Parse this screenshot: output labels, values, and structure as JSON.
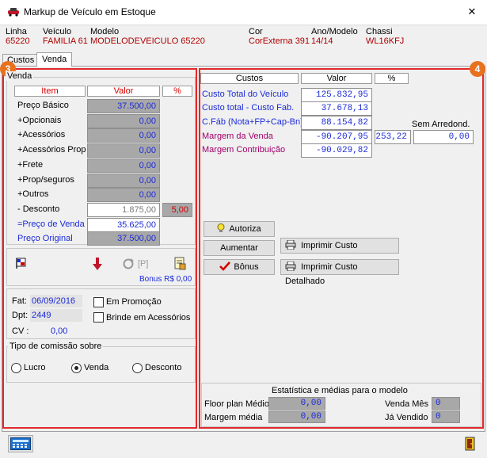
{
  "window": {
    "title": "Markup de Veículo em Estoque",
    "close": "✕"
  },
  "header": {
    "labels": {
      "linha": "Linha",
      "veiculo": "Veículo",
      "modelo": "Modelo",
      "cor": "Cor",
      "ano": "Ano/Modelo",
      "chassi": "Chassi"
    },
    "values": {
      "linha": "65220",
      "veiculo": "FAMILIA 61",
      "modelo": "MODELODEVEICULO 65220",
      "cor": "CorExterna 391",
      "ano": "14/14",
      "chassi": "WL16KFJ"
    }
  },
  "tabs": {
    "custos": "Custos",
    "venda": "Venda"
  },
  "badges": {
    "left": "3",
    "right": "4"
  },
  "venda": {
    "group_title": "Venda",
    "col_item": "Item",
    "col_valor": "Valor",
    "col_pct": "%",
    "rows": [
      {
        "label": "Preço Básico",
        "value": "37.500,00"
      },
      {
        "label": "+Opcionais",
        "value": "0,00"
      },
      {
        "label": "+Acessórios",
        "value": "0,00"
      },
      {
        "label": "+Acessórios Prop",
        "value": "0,00"
      },
      {
        "label": "+Frete",
        "value": "0,00"
      },
      {
        "label": "+Prop/seguros",
        "value": "0,00"
      },
      {
        "label": "+Outros",
        "value": "0,00"
      }
    ],
    "desconto": {
      "label": "- Desconto",
      "value": "1.875,00",
      "pct": "5,00"
    },
    "preco_venda": {
      "label": "=Preço de Venda",
      "value": "35.625,00"
    },
    "preco_original": {
      "label": "Preço Original",
      "value": "37.500,00"
    },
    "bonus_text": "Bonus R$ 0,00",
    "p_label": "[P]"
  },
  "info": {
    "fat_label": "Fat:",
    "fat_value": "06/09/2016",
    "dpt_label": "Dpt:",
    "dpt_value": "2449",
    "cv_label": "CV :",
    "cv_value": "0,00",
    "em_promocao": "Em Promoção",
    "brinde": "Brinde em Acessórios"
  },
  "comissao": {
    "title": "Tipo de comissão sobre",
    "options": [
      "Lucro",
      "Venda",
      "Desconto"
    ],
    "selected": "Venda"
  },
  "custos": {
    "col_custos": "Custos",
    "col_valor": "Valor",
    "col_pct": "%",
    "rows": [
      {
        "label": "Custo Total do Veículo",
        "value": "125.832,95"
      },
      {
        "label": "Custo total - Custo Fab.",
        "value": "37.678,13"
      },
      {
        "label": "C.Fáb (Nota+FP+Cap-Bn)",
        "value": "88.154,82"
      },
      {
        "label": "Margem da Venda",
        "value": "-90.207,95",
        "pct": "253,22"
      },
      {
        "label": "Margem Contribuição",
        "value": "-90.029,82"
      }
    ],
    "sem_arredond_label": "Sem Arredond.",
    "sem_arredond_value": "0,00"
  },
  "buttons": {
    "autoriza": "Autoriza",
    "aumentar": "Aumentar",
    "bonus": "Bônus",
    "imprimir_custo": "Imprimir Custo",
    "imprimir_custo_detalhado": "Imprimir Custo Detalhado"
  },
  "estatistica": {
    "title": "Estatística e médias para o modelo",
    "floor_label": "Floor plan Médio",
    "floor_value": "0,00",
    "margem_label": "Margem média",
    "margem_value": "0,00",
    "venda_mes_label": "Venda Mês",
    "venda_mes_value": "0",
    "ja_vendido_label": "Já Vendido",
    "ja_vendido_value": "0"
  },
  "colors": {
    "accent_red": "#e1292b",
    "badge_orange": "#e8711e",
    "value_blue": "#1c2bd8",
    "margin_maroon": "#a0006c"
  }
}
